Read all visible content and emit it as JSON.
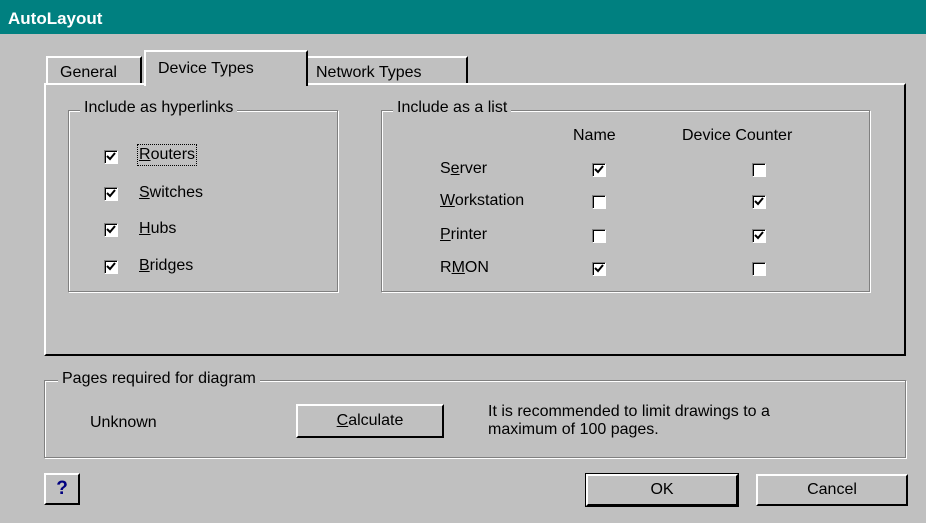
{
  "window": {
    "title": "AutoLayout"
  },
  "tabs": [
    {
      "label": "General"
    },
    {
      "label": "Device Types"
    },
    {
      "label": "Network Types"
    }
  ],
  "hyperlinks_group": {
    "label": "Include as hyperlinks",
    "items": [
      {
        "pre": "",
        "mn": "R",
        "post": "outers",
        "checked": true
      },
      {
        "pre": "",
        "mn": "S",
        "post": "witches",
        "checked": true
      },
      {
        "pre": "",
        "mn": "H",
        "post": "ubs",
        "checked": true
      },
      {
        "pre": "",
        "mn": "B",
        "post": "ridges",
        "checked": true
      }
    ]
  },
  "list_group": {
    "label": "Include as a list",
    "col_name": "Name",
    "col_counter": "Device Counter",
    "rows": [
      {
        "pre": "S",
        "mn": "e",
        "post": "rver",
        "name": true,
        "counter": false
      },
      {
        "pre": "",
        "mn": "W",
        "post": "orkstation",
        "name": false,
        "counter": true
      },
      {
        "pre": "",
        "mn": "P",
        "post": "rinter",
        "name": false,
        "counter": true
      },
      {
        "pre": "R",
        "mn": "M",
        "post": "ON",
        "name": true,
        "counter": false
      }
    ]
  },
  "pages_group": {
    "label": "Pages required for diagram",
    "status": "Unknown",
    "calculate_pre": "",
    "calculate_mn": "C",
    "calculate_post": "alculate",
    "note_line1": "It is recommended to limit drawings to a",
    "note_line2": "maximum of 100 pages."
  },
  "buttons": {
    "help": "?",
    "ok": "OK",
    "cancel": "Cancel"
  },
  "colors": {
    "title_bar": "#008080",
    "face": "#c0c0c0",
    "help_glyph": "#000080"
  }
}
